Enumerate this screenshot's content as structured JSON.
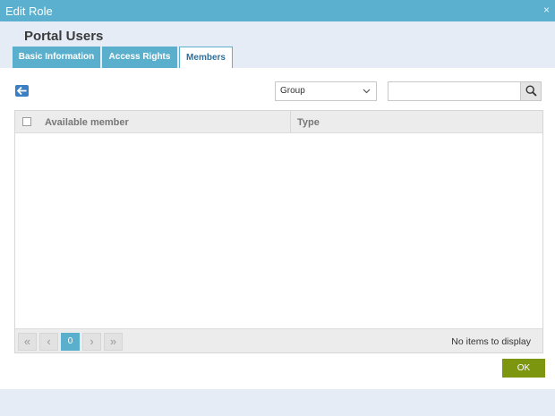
{
  "window": {
    "title": "Edit Role",
    "close_glyph": "×"
  },
  "page_title": "Portal Users",
  "tabs": [
    {
      "label": "Basic Information",
      "active": false
    },
    {
      "label": "Access Rights",
      "active": false
    },
    {
      "label": "Members",
      "active": true
    }
  ],
  "toolbar": {
    "back_icon": "arrow-left-icon",
    "filter_select": {
      "value": "Group"
    },
    "search": {
      "value": "",
      "placeholder": "",
      "icon": "search-icon"
    }
  },
  "grid": {
    "columns": [
      "Available member",
      "Type"
    ],
    "rows": []
  },
  "pager": {
    "first": "«",
    "prev": "‹",
    "page": "0",
    "next": "›",
    "last": "»",
    "info": "No items to display"
  },
  "ok_label": "OK",
  "colors": {
    "titlebar": "#5ab0ce",
    "tab": "#5aafcc",
    "ok_button": "#7d960f",
    "back_button": "#3a7fc4"
  }
}
